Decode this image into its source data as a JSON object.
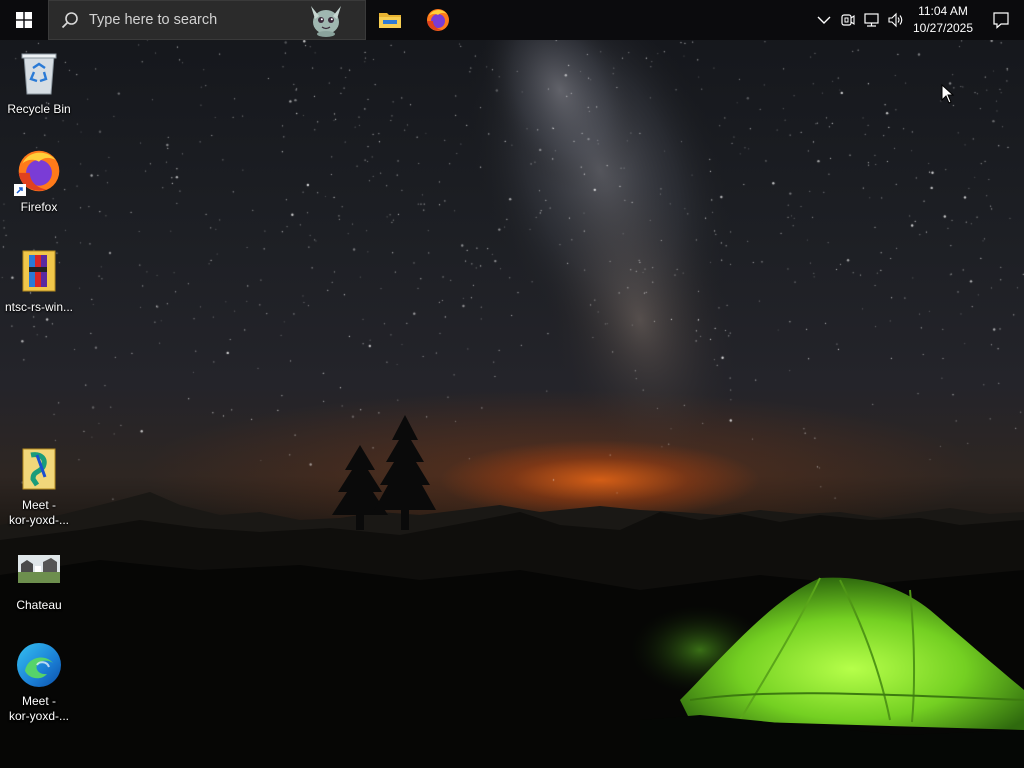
{
  "wallpaper": {
    "description_colors": {
      "sky": "#1d1f24",
      "glow": "#ff6e14",
      "tent": "#7ddc2a"
    }
  },
  "taskbar": {
    "search": {
      "placeholder": "Type here to search"
    },
    "apps": [
      {
        "name": "File Explorer",
        "icon": "folder-icon"
      },
      {
        "name": "Firefox",
        "icon": "firefox-icon"
      }
    ],
    "tray": {
      "icons": [
        "chevron-up-icon",
        "meet-now-icon",
        "network-icon",
        "volume-icon"
      ],
      "time": "11:04 AM",
      "date": "10/27/2025"
    },
    "notification_icon": "notification-icon"
  },
  "desktop_icons": [
    {
      "label": "Recycle Bin",
      "icon": "recycle-bin-icon"
    },
    {
      "label": "Firefox",
      "icon": "firefox-icon"
    },
    {
      "label": "ntsc-rs-win...",
      "icon": "zip-folder-icon"
    },
    {
      "label": "Meet -\nkor-yoxd-...",
      "icon": "shortcut-icon"
    },
    {
      "label": "Chateau",
      "icon": "image-file-icon"
    },
    {
      "label": "Meet -\nkor-yoxd-...",
      "icon": "edge-icon"
    }
  ]
}
